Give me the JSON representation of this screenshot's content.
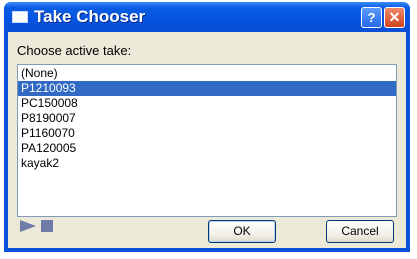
{
  "window": {
    "title": "Take Chooser"
  },
  "titlebar": {
    "help_label": "?",
    "close_label": "✕"
  },
  "prompt": "Choose active take:",
  "takes": {
    "items": [
      "(None)",
      "P1210093",
      "PC150008",
      "P8190007",
      "P1160070",
      "PA120005",
      "kayak2"
    ],
    "selected": "P1210093"
  },
  "buttons": {
    "ok": "OK",
    "cancel": "Cancel"
  },
  "colors": {
    "titlebar": "#0a5ce4",
    "selection": "#316ac5",
    "client": "#ece9d8"
  }
}
